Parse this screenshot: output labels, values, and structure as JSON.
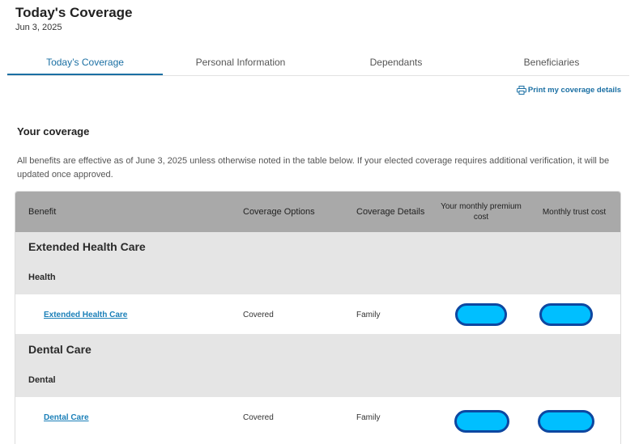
{
  "header": {
    "title": "Today's Coverage",
    "date": "Jun 3, 2025"
  },
  "tabs": [
    {
      "label": "Today’s Coverage",
      "active": true
    },
    {
      "label": "Personal Information",
      "active": false
    },
    {
      "label": "Dependants",
      "active": false
    },
    {
      "label": "Beneficiaries",
      "active": false
    }
  ],
  "print_link": {
    "label": "Print my coverage details",
    "icon": "printer-icon"
  },
  "coverage": {
    "heading": "Your coverage",
    "intro": "All benefits are effective as of June 3, 2025 unless otherwise noted in the table below. If your elected coverage requires additional verification, it will be updated once approved."
  },
  "table": {
    "columns": [
      "Benefit",
      "Coverage Options",
      "Coverage Details",
      "Your monthly premium cost",
      "Monthly trust cost"
    ],
    "groups": [
      {
        "title": "Extended Health Care",
        "subtitle": "Health",
        "rows": [
          {
            "benefit": "Extended Health Care",
            "option": "Covered",
            "details": "Family"
          }
        ]
      },
      {
        "title": "Dental Care",
        "subtitle": "Dental",
        "rows": [
          {
            "benefit": "Dental Care",
            "option": "Covered",
            "details": "Family"
          }
        ]
      }
    ]
  },
  "colors": {
    "accent": "#1a6fa3",
    "header_bg": "#a9a9a9",
    "group_bg": "#e5e5e5",
    "redaction_fill": "#00bfff",
    "redaction_border": "#0d47a1"
  }
}
